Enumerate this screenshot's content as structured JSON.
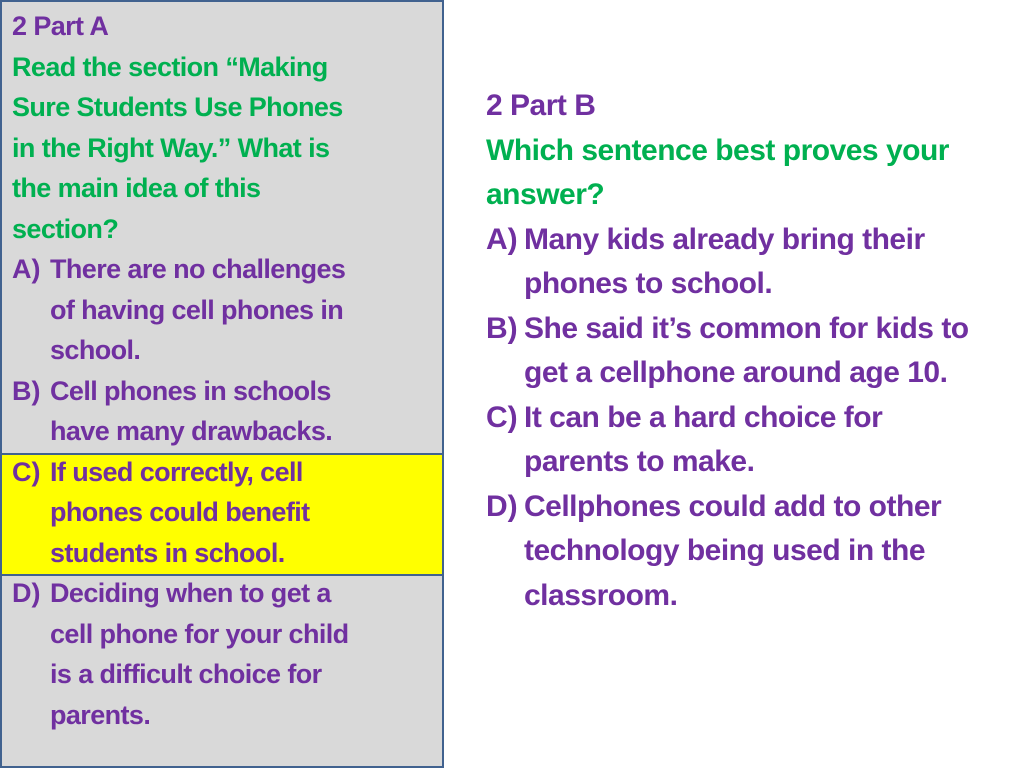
{
  "part_a": {
    "heading": "2 Part A",
    "question_lines": [
      "Read the section “Making",
      "Sure Students Use Phones",
      "in the Right Way.”  What is",
      "the main idea of this",
      "section?"
    ],
    "options": [
      {
        "letter": "A)",
        "text": "There are no challenges\nof having cell phones in\nschool.",
        "highlighted": false
      },
      {
        "letter": "B)",
        "text": "Cell phones in schools\nhave many drawbacks.",
        "highlighted": false
      },
      {
        "letter": "C)",
        "text": "If used correctly, cell\nphones could benefit\nstudents in school.",
        "highlighted": true
      },
      {
        "letter": "D)",
        "text": "Deciding when to get a\ncell phone for your child\nis a difficult choice for\nparents.",
        "highlighted": false
      }
    ]
  },
  "part_b": {
    "heading": "2 Part B",
    "question_lines": [
      "Which sentence best proves your",
      "answer?"
    ],
    "options": [
      {
        "letter": "A)",
        "text": "Many kids already bring their\nphones to school."
      },
      {
        "letter": "B)",
        "text": "She said it’s common for kids to\nget a cellphone around age 10."
      },
      {
        "letter": "C)",
        "text": "It can be a hard choice for\nparents to make."
      },
      {
        "letter": "D)",
        "text": "Cellphones could add to other\ntechnology being used in the\nclassroom."
      }
    ]
  },
  "colors": {
    "heading": "#7030a0",
    "question": "#00b050",
    "options": "#7030a0",
    "highlight": "#ffff00",
    "panel_bg": "#d9d9d9",
    "panel_border": "#41628f"
  }
}
